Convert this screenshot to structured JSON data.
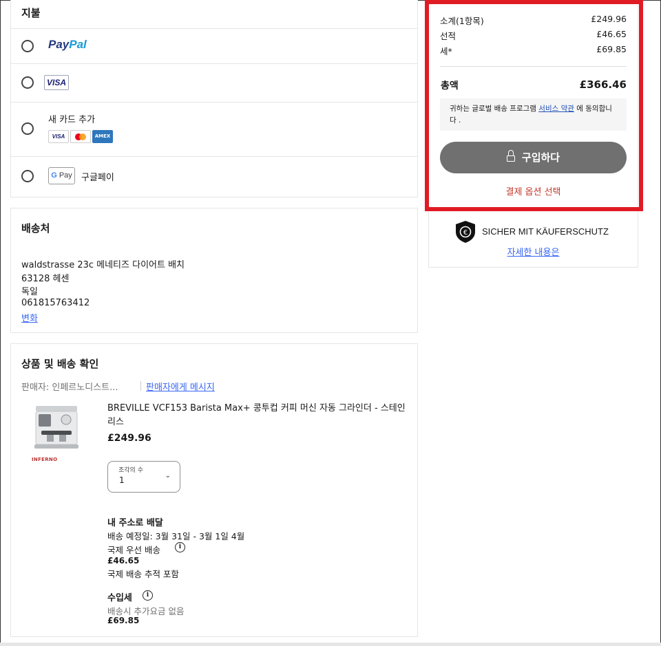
{
  "payment": {
    "title": "지불",
    "options": [
      {
        "id": "paypal",
        "brand_part1": "Pay",
        "brand_part2": "Pal"
      },
      {
        "id": "visa",
        "brand": "VISA"
      },
      {
        "id": "new_card",
        "label": "새 카드 추가",
        "networks": [
          "VISA",
          "MC",
          "AMEX"
        ]
      },
      {
        "id": "gpay",
        "badge_g": "G",
        "badge_text": "Pay",
        "label": "구글페이"
      }
    ]
  },
  "shipping": {
    "title": "배송처",
    "address_line1": "waldstrasse 23c 메네티즈 다이어트 배치",
    "address_line2": "63128 헤센",
    "country": "독일",
    "phone": "061815763412",
    "change_link": "변화"
  },
  "items": {
    "title": "상품 및 배송 확인",
    "seller_label": "판매자:  인페르노디스트...",
    "message_link": "판매자에게 메시지",
    "product": {
      "name": "BREVILLE VCF153 Barista Max+ 콩투컵 커피 머신 자동 그라인더 - 스테인리스",
      "price": "£249.96",
      "image_caption": "INFERNO"
    },
    "quantity": {
      "label": "조각의 수",
      "value": "1"
    },
    "delivery": {
      "heading": "내 주소로 배달",
      "estimate": "배송 예정일: 3월 31일 - 3월 1일 4월",
      "method": "국제 우선 배송",
      "cost": "£46.65",
      "tracking": "국제 배송 추적 포함"
    },
    "import_tax": {
      "heading": "수입세",
      "note": "배송시 추가요금 없음",
      "amount": "£69.85"
    }
  },
  "summary": {
    "subtotal_label": "소계(1항목)",
    "subtotal_value": "£249.96",
    "shipping_label": "선적",
    "shipping_value": "£46.65",
    "tax_label": "세*",
    "tax_value": "£69.85",
    "total_label": "총액",
    "total_value": "£366.46",
    "terms_prefix": "귀하는 글로벌 배송 프로그램 ",
    "terms_link": "서비스 약관",
    "terms_suffix": " 에 동의합니다 .",
    "buy_button": "구입하다",
    "choose_payment": "결제 옵션 선택",
    "protection_text": "SICHER MIT KÄUFERSCHUTZ",
    "protection_link": "자세한 내용은"
  },
  "colors": {
    "highlight_border": "#e01b24",
    "buy_button_bg": "#707070",
    "link": "#3665f3",
    "choose_payment_text": "#c0392b"
  }
}
